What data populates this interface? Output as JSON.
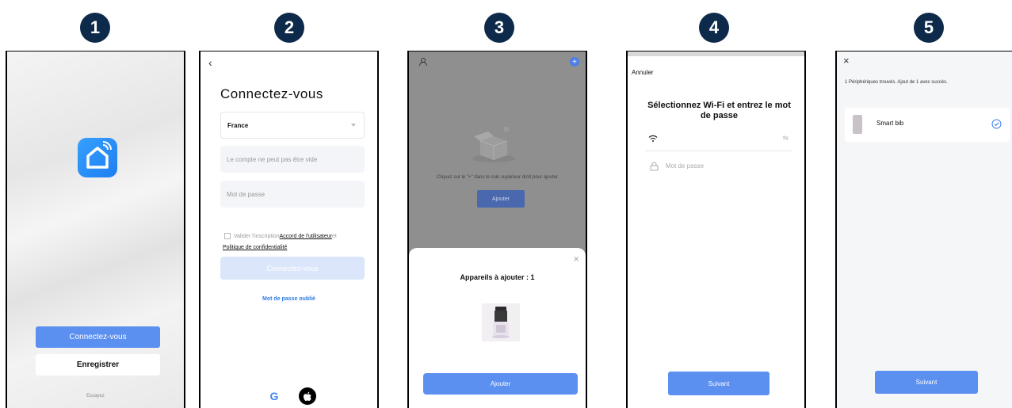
{
  "steps": [
    "1",
    "2",
    "3",
    "4",
    "5"
  ],
  "colors": {
    "badge": "#0e2a4a",
    "primary_button": "#5b8ff0",
    "link": "#2e7be6"
  },
  "screen1": {
    "app_icon": "home-icon",
    "login_button": "Connectez-vous",
    "register_button": "Enregistrer",
    "try_link": "Essayez"
  },
  "screen2": {
    "title": "Connectez-vous",
    "country": "France",
    "account_placeholder": "Le compte ne peut pas être vide",
    "password_placeholder": "Mot de passe",
    "agree_text": "Valider l'inscription",
    "user_agreement_link": "Accord de l'utilisateur",
    "agree_and": "et",
    "privacy_link": "Politique de confidentialité",
    "submit_button": "Connectez-vous",
    "forgot_password": "Mot de passe oublié",
    "social_google": "G"
  },
  "screen3": {
    "hint": "Cliquez sur le \"+\" dans le coin supérieur droit pour ajouter",
    "background_add_button": "Ajouter",
    "sheet_title": "Appareils à ajouter : 1",
    "sheet_add_button": "Ajouter"
  },
  "screen4": {
    "cancel": "Annuler",
    "title": "Sélectionnez Wi-Fi et entrez le mot de passe",
    "password_placeholder": "Mot de passe",
    "next_button": "Suivant"
  },
  "screen5": {
    "found_text": "1 Périphériques trouvés. Ajout de 1 avec succès.",
    "device_name": "Smart bib",
    "next_button": "Suivant"
  }
}
